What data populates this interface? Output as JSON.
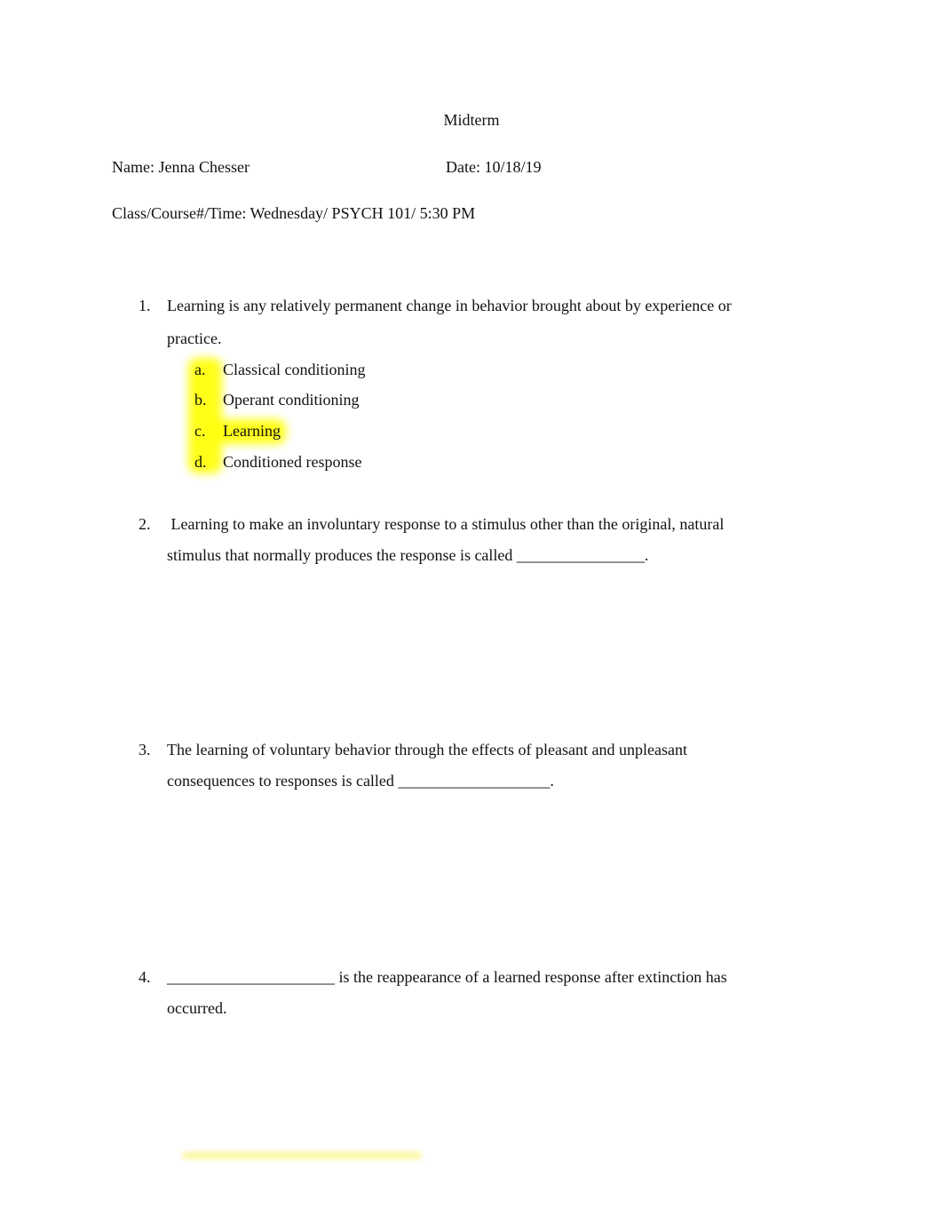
{
  "document": {
    "title": "Midterm",
    "name_line": "Name: Jenna Chesser",
    "date_line": "Date: 10/18/19",
    "class_line": "Class/Course#/Time: Wednesday/ PSYCH 101/ 5:30 PM"
  },
  "questions": [
    {
      "number": "1.",
      "lines": [
        "Learning is any relatively permanent change in behavior brought about by experience or",
        "practice."
      ],
      "options": [
        {
          "letter": "a.",
          "text": "Classical conditioning"
        },
        {
          "letter": "b.",
          "text": "Operant conditioning"
        },
        {
          "letter": "c.",
          "text": "Learning"
        },
        {
          "letter": "d.",
          "text": "Conditioned response"
        }
      ],
      "highlighted_answer": "c"
    },
    {
      "number": "2.",
      "lines": [
        " Learning to make an involuntary response to a stimulus other than the original, natural",
        "stimulus that normally produces the response is called ________________."
      ]
    },
    {
      "number": "3.",
      "lines": [
        "The learning of voluntary behavior through the effects of pleasant and unpleasant",
        "consequences to responses is called ___________________."
      ]
    },
    {
      "number": "4.",
      "lines": [
        "_____________________ is the reappearance of a learned response after extinction has",
        "occurred."
      ]
    }
  ],
  "colors": {
    "highlight": "#ffff00"
  }
}
